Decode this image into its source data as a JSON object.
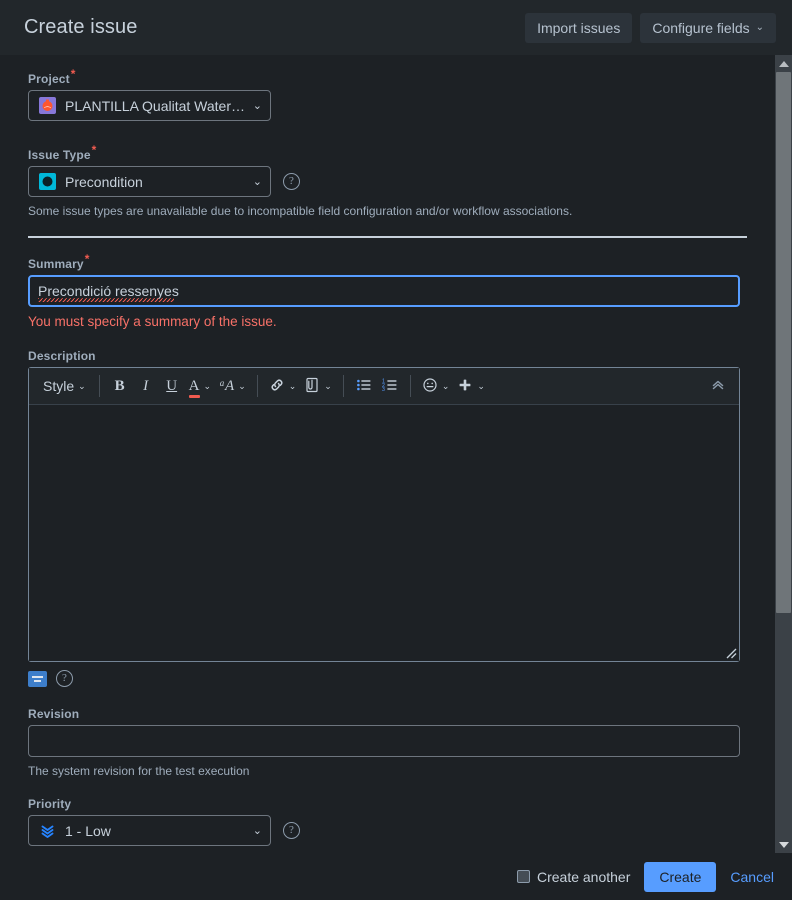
{
  "header": {
    "title": "Create issue",
    "import_label": "Import issues",
    "configure_label": "Configure fields",
    "configure_caret": "⌄"
  },
  "form": {
    "project": {
      "label": "Project",
      "required_mark": "*",
      "value": "PLANTILLA Qualitat Waterf…",
      "icon": "project-flask-icon",
      "caret": "⌄"
    },
    "issue_type": {
      "label": "Issue Type",
      "required_mark": "*",
      "value": "Precondition",
      "icon": "precondition-icon",
      "caret": "⌄",
      "help_icon": "?",
      "note": "Some issue types are unavailable due to incompatible field configuration and/or workflow associations."
    },
    "summary": {
      "label": "Summary",
      "required_mark": "*",
      "value": "Precondició ressenyes",
      "placeholder": "",
      "error": "You must specify a summary of the issue."
    },
    "description": {
      "label": "Description",
      "value": "",
      "placeholder": "",
      "toolbar": {
        "style_label": "Style",
        "style_caret": "⌄",
        "bold": "B",
        "italic": "I",
        "underline": "U",
        "text_color": "A",
        "text_color_caret": "⌄",
        "more_formatting": "ᵃA",
        "more_formatting_caret": "⌄",
        "link": "link-icon",
        "link_caret": "⌄",
        "attach": "attachment-icon",
        "attach_caret": "⌄",
        "bullet_list": "bullet-list-icon",
        "numbered_list": "numbered-list-icon",
        "emoji": "emoji-icon",
        "emoji_caret": "⌄",
        "insert_more": "+",
        "insert_more_caret": "⌄",
        "collapse": "«"
      },
      "footer": {
        "preview_icon": "preview-icon",
        "help_icon": "?"
      }
    },
    "revision": {
      "label": "Revision",
      "value": "",
      "placeholder": "",
      "helptext": "The system revision for the test execution"
    },
    "priority": {
      "label": "Priority",
      "value": "1 - Low",
      "icon": "priority-low-icon",
      "caret": "⌄",
      "help_icon": "?"
    }
  },
  "footer": {
    "create_another_label": "Create another",
    "create_another_checked": false,
    "create_label": "Create",
    "cancel_label": "Cancel"
  },
  "scrollbar": {
    "up_arrow": "scroll-up-icon",
    "down_arrow": "scroll-down-icon"
  },
  "colors": {
    "background": "#1d2125",
    "header_bg": "#22272b",
    "accent": "#579dff",
    "error": "#f87168",
    "required": "#f15b50",
    "label": "#9fadbc",
    "text": "#c7d1db"
  }
}
